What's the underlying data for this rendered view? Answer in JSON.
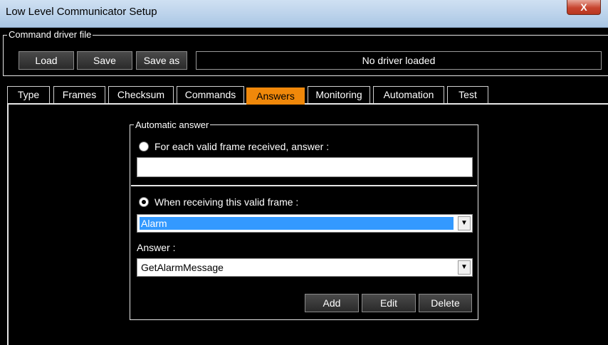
{
  "window": {
    "title": "Low Level Communicator Setup",
    "close_glyph": "X"
  },
  "driver_group": {
    "label": "Command driver file",
    "load_label": "Load",
    "save_label": "Save",
    "save_as_label": "Save as",
    "status": "No driver loaded"
  },
  "tabs": [
    {
      "label": "Type"
    },
    {
      "label": "Frames"
    },
    {
      "label": "Checksum"
    },
    {
      "label": "Commands"
    },
    {
      "label": "Answers",
      "active": true
    },
    {
      "label": "Monitoring"
    },
    {
      "label": "Automation"
    },
    {
      "label": "Test"
    }
  ],
  "auto_answer": {
    "group_label": "Automatic answer",
    "option_each_label": "For each valid frame received, answer :",
    "option_each_value": "",
    "option_when_label": "When receiving this valid frame :",
    "frame_selected": "Alarm",
    "answer_label": "Answer :",
    "answer_selected": "GetAlarmMessage",
    "add_label": "Add",
    "edit_label": "Edit",
    "delete_label": "Delete"
  },
  "colors": {
    "accent_tab": "#f0880a",
    "selection": "#3399ff",
    "background": "#000000"
  }
}
